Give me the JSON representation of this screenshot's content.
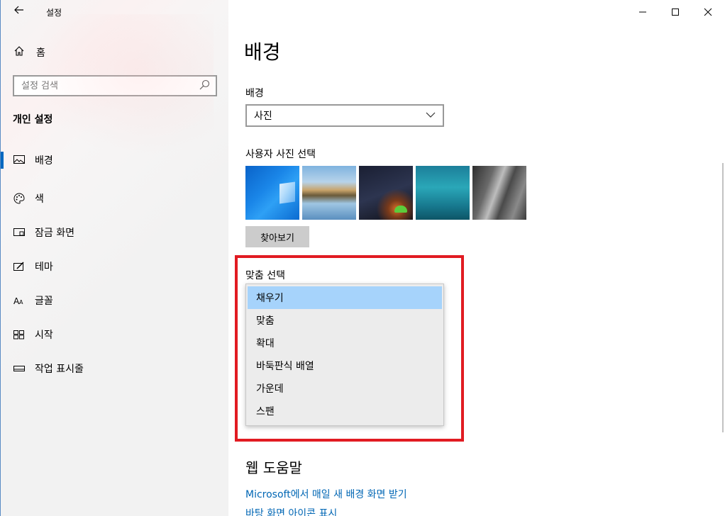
{
  "window": {
    "app_title": "설정",
    "controls": {
      "minimize": "—",
      "maximize": "☐",
      "close": "✕"
    }
  },
  "sidebar": {
    "home_label": "홈",
    "search_placeholder": "설정 검색",
    "section_title": "개인 설정",
    "items": [
      {
        "label": "배경",
        "icon": "picture-icon",
        "active": true
      },
      {
        "label": "색",
        "icon": "palette-icon"
      },
      {
        "label": "잠금 화면",
        "icon": "lock-screen-icon"
      },
      {
        "label": "테마",
        "icon": "theme-icon"
      },
      {
        "label": "글꼴",
        "icon": "font-icon"
      },
      {
        "label": "시작",
        "icon": "start-icon"
      },
      {
        "label": "작업 표시줄",
        "icon": "taskbar-icon"
      }
    ]
  },
  "main": {
    "page_title": "배경",
    "background_label": "배경",
    "background_value": "사진",
    "choose_photo_label": "사용자 사진 선택",
    "browse_label": "찾아보기",
    "fit_label": "맞춤 선택",
    "fit_options": [
      "채우기",
      "맞춤",
      "확대",
      "바둑판식 배열",
      "가운데",
      "스팬"
    ],
    "fit_selected": "채우기",
    "web_help_title": "웹 도움말",
    "links": [
      "Microsoft에서 매일 새 배경 화면 받기",
      "바탕 화면 아이콘 표시"
    ]
  },
  "colors": {
    "accent": "#0067c0",
    "highlight_box": "#e11b22",
    "selected_option": "#a6d3fb",
    "link": "#0066b4"
  }
}
